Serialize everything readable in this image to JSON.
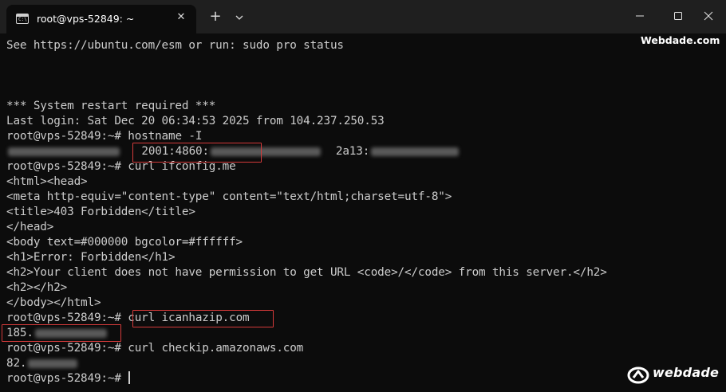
{
  "window": {
    "tab_title": "root@vps-52849: ~",
    "tab_icon_prompt": "C:\\",
    "tab_close": "✕",
    "new_tab": "+"
  },
  "watermark": {
    "top_text": "Webdade.com",
    "logo_text": "webdade"
  },
  "terminal": {
    "line_01": "See https://ubuntu.com/esm or run: sudo pro status",
    "line_02": "*** System restart required ***",
    "line_03": "Last login: Sat Dec 20 06:34:53 2025 from 104.237.250.53",
    "line_04_prompt": "root@vps-52849:~#",
    "line_04_cmd": "hostname -I",
    "line_05_a": "2001:4860:",
    "line_05_b": "2a13:",
    "line_06_prompt": "root@vps-52849:~#",
    "line_06_cmd": "curl ifconfig.me",
    "line_07": "<html><head>",
    "line_08": "<meta http-equiv=\"content-type\" content=\"text/html;charset=utf-8\">",
    "line_09": "<title>403 Forbidden</title>",
    "line_10": "</head>",
    "line_11": "<body text=#000000 bgcolor=#ffffff>",
    "line_12": "<h1>Error: Forbidden</h1>",
    "line_13": "<h2>Your client does not have permission to get URL <code>/</code> from this server.</h2>",
    "line_14": "<h2></h2>",
    "line_15": "</body></html>",
    "line_16_prompt": "root@vps-52849:~#",
    "line_16_cmd": "curl icanhazip.com",
    "line_17": "185.",
    "line_18_prompt": "root@vps-52849:~#",
    "line_18_cmd": "curl checkip.amazonaws.com",
    "line_19": "82.",
    "line_20_prompt": "root@vps-52849:~#"
  },
  "colors": {
    "background": "#0c0c0c",
    "titlebar": "#1f1f1f",
    "text": "#cccccc",
    "highlight": "#d43a3a"
  }
}
